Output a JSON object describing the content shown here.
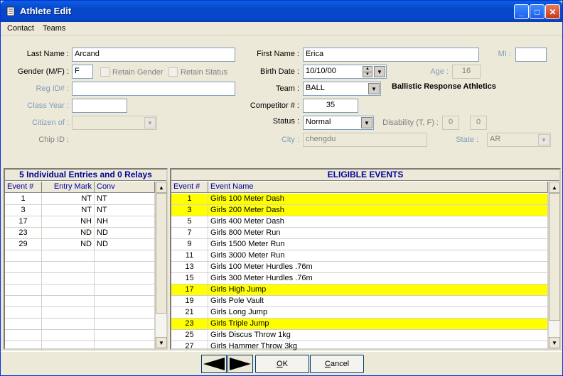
{
  "window": {
    "title": "Athlete Edit"
  },
  "menu": [
    "Contact",
    "Teams"
  ],
  "form": {
    "last_name_label": "Last Name :",
    "last_name": "Arcand",
    "first_name_label": "First Name :",
    "first_name": "Erica",
    "mi_label": "MI :",
    "mi": "",
    "gender_label": "Gender (M/F) :",
    "gender": "F",
    "retain_gender_label": "Retain Gender",
    "retain_status_label": "Retain Status",
    "birth_date_label": "Birth Date :",
    "birth_date": "10/10/00",
    "age_label": "Age :",
    "age": "16",
    "reg_id_label": "Reg ID# :",
    "reg_id": "",
    "team_label": "Team :",
    "team": "BALL",
    "team_name": "Ballistic Response Athletics",
    "class_year_label": "Class Year :",
    "class_year": "",
    "competitor_label": "Competitor # :",
    "competitor": "35",
    "citizen_label": "Citizen of :",
    "citizen": "",
    "status_label": "Status :",
    "status": "Normal",
    "disability_label": "Disability (T, F) :",
    "disability_1": "0",
    "disability_2": "0",
    "chip_id_label": "Chip ID :",
    "city_label": "City :",
    "city": "chengdu",
    "state_label": "State :",
    "state": "AR"
  },
  "entries_panel": {
    "header": "5 Individual Entries and 0 Relays",
    "columns": [
      "Event #",
      "Entry Mark",
      "Conv"
    ],
    "rows": [
      [
        "1",
        "NT",
        "NT"
      ],
      [
        "3",
        "NT",
        "NT"
      ],
      [
        "17",
        "NH",
        "NH"
      ],
      [
        "23",
        "ND",
        "ND"
      ],
      [
        "29",
        "ND",
        "ND"
      ]
    ]
  },
  "events_panel": {
    "header": "ELIGIBLE EVENTS",
    "columns": [
      "Event #",
      "Event Name"
    ],
    "rows": [
      {
        "num": "1",
        "name": "Girls 100 Meter Dash",
        "selected": true
      },
      {
        "num": "3",
        "name": "Girls 200 Meter Dash",
        "selected": true
      },
      {
        "num": "5",
        "name": "Girls 400 Meter Dash",
        "selected": false
      },
      {
        "num": "7",
        "name": "Girls 800 Meter Run",
        "selected": false
      },
      {
        "num": "9",
        "name": "Girls 1500 Meter Run",
        "selected": false
      },
      {
        "num": "11",
        "name": "Girls 3000 Meter Run",
        "selected": false
      },
      {
        "num": "13",
        "name": "Girls 100 Meter Hurdles .76m",
        "selected": false
      },
      {
        "num": "15",
        "name": "Girls 300 Meter Hurdles .76m",
        "selected": false
      },
      {
        "num": "17",
        "name": "Girls High Jump",
        "selected": true
      },
      {
        "num": "19",
        "name": "Girls Pole Vault",
        "selected": false
      },
      {
        "num": "21",
        "name": "Girls Long Jump",
        "selected": false
      },
      {
        "num": "23",
        "name": "Girls Triple Jump",
        "selected": true
      },
      {
        "num": "25",
        "name": "Girls Discus Throw 1kg",
        "selected": false
      },
      {
        "num": "27",
        "name": "Girls Hammer Throw 3kg",
        "selected": false
      }
    ]
  },
  "buttons": {
    "ok": "OK",
    "ok_accel": "O",
    "ok_rest": "K",
    "cancel_accel": "C",
    "cancel_rest": "ancel"
  },
  "colors": {
    "highlight": "#ffff00",
    "title_blue": "#0846c7",
    "label_disabled": "#7f9db9"
  },
  "icons": [
    "app-icon",
    "minimize-icon",
    "maximize-icon",
    "close-icon",
    "chevron-down-icon",
    "spin-up-icon",
    "spin-down-icon",
    "arrow-left-icon",
    "arrow-right-icon",
    "scroll-up-icon",
    "scroll-down-icon"
  ]
}
